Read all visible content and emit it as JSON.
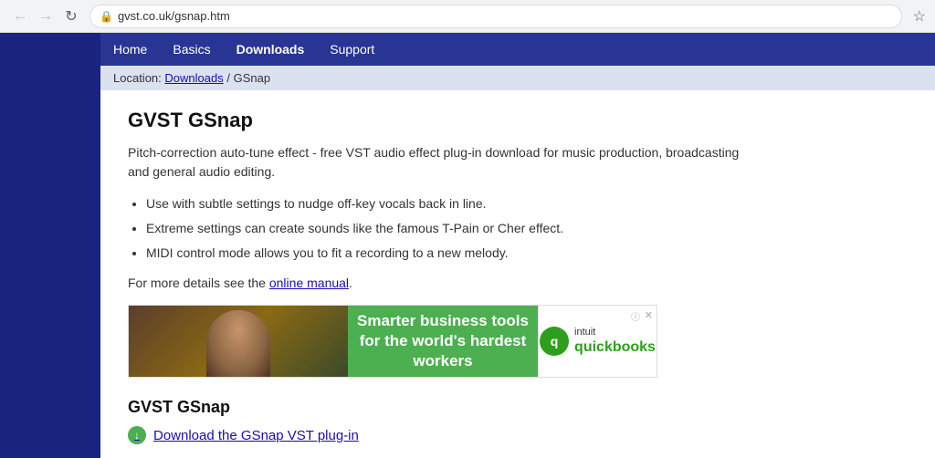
{
  "browser": {
    "url": "gvst.co.uk/gsnap.htm",
    "back_btn": "←",
    "forward_btn": "→",
    "refresh_btn": "↻",
    "star_btn": "☆"
  },
  "nav": {
    "items": [
      {
        "label": "Home",
        "active": false
      },
      {
        "label": "Basics",
        "active": false
      },
      {
        "label": "Downloads",
        "active": true
      },
      {
        "label": "Support",
        "active": false
      }
    ]
  },
  "breadcrumb": {
    "prefix": "Location:",
    "link_text": "Downloads",
    "separator": "/",
    "current": "GSnap"
  },
  "main": {
    "title": "GVST GSnap",
    "description": "Pitch-correction auto-tune effect - free VST audio effect plug-in download for music production, broadcasting and general audio editing.",
    "features": [
      "Use with subtle settings to nudge off-key vocals back in line.",
      "Extreme settings can create sounds like the famous T-Pain or Cher effect.",
      "MIDI control mode allows you to fit a recording to a new melody."
    ],
    "manual_prefix": "For more details see the",
    "manual_link": "online manual",
    "manual_suffix": "."
  },
  "ad": {
    "green_text_line1": "Smarter business tools",
    "green_text_line2": "for the world's hardest workers",
    "info_label": "ⓘ",
    "close_label": "✕",
    "qb_symbol": "q",
    "qb_brand_prefix": "intuit",
    "qb_brand": "quickbooks"
  },
  "download_section": {
    "title": "GVST GSnap",
    "link_text": "Download the GSnap VST plug-in",
    "icon": "↓"
  }
}
